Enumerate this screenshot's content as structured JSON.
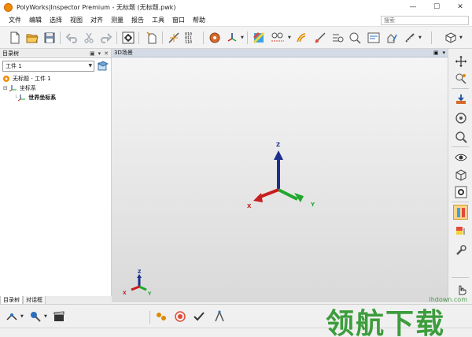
{
  "window": {
    "title": "PolyWorks|Inspector Premium - 无标题 (无标题.pwk)",
    "minimize": "—",
    "maximize": "☐",
    "close": "✕"
  },
  "menu": {
    "items": [
      "文件",
      "编辑",
      "选择",
      "视图",
      "对齐",
      "测量",
      "报告",
      "工具",
      "窗口",
      "帮助"
    ],
    "search_placeholder": "搜索"
  },
  "left_panel": {
    "title": "目录树",
    "combo_value": "工件 1",
    "tree": [
      {
        "label": "无标题 - 工件 1",
        "level": 0
      },
      {
        "label": "坐标系",
        "level": 1
      },
      {
        "label": "世界坐标系",
        "level": 2
      }
    ],
    "tabs": [
      "目录树",
      "对话框"
    ]
  },
  "viewport": {
    "title": "3D场景",
    "axis_labels": {
      "x": "X",
      "y": "Y",
      "z": "Z"
    },
    "small_axis_labels": {
      "x": "X",
      "y": "Y",
      "z": "Z"
    }
  },
  "watermark": {
    "url": "lhdown.com",
    "text": "领航下载"
  },
  "toolbar_icons": [
    "new-file-icon",
    "open-folder-icon",
    "save-icon",
    "undo-icon",
    "cut-icon",
    "redo-icon",
    "settings-icon",
    "new-object-icon",
    "sparkle-tool-icon",
    "binary-icon",
    "align-icon",
    "axis-tool-icon",
    "pattern-icon",
    "feature-icon",
    "probe-icon",
    "measure-icon",
    "zoom-icon",
    "dialog-icon",
    "report-icon",
    "view-icon"
  ],
  "colors": {
    "axis_x": "#c81e1e",
    "axis_y": "#1fa82b",
    "axis_z": "#1c2f8f",
    "accent": "#f08a00",
    "viewport_header": "#d5dbe6"
  }
}
